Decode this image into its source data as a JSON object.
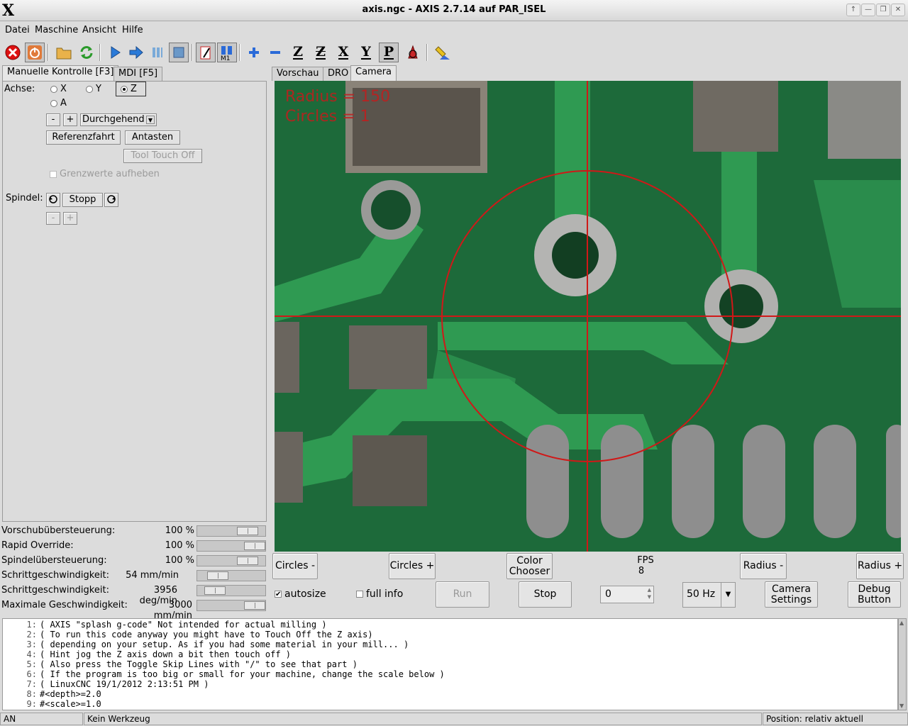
{
  "window": {
    "title": "axis.ngc - AXIS 2.7.14 auf  PAR_ISEL",
    "logo": "X"
  },
  "menu": [
    "Datei",
    "Maschine",
    "Ansicht",
    "Hilfe"
  ],
  "left_tabs": [
    "Manuelle Kontrolle [F3]",
    "MDI [F5]"
  ],
  "right_tabs": [
    "Vorschau",
    "DRO",
    "Camera"
  ],
  "manual": {
    "axis_label": "Achse:",
    "axes": [
      "X",
      "Y",
      "Z",
      "A"
    ],
    "selected_axis": "Z",
    "jog_minus": "-",
    "jog_plus": "+",
    "jog_mode": "Durchgehend",
    "home_button": "Referenzfahrt",
    "touch_button": "Antasten",
    "tool_touch_off": "Tool Touch Off",
    "override_limits": "Grenzwerte aufheben",
    "spindle_label": "Spindel:",
    "spindle_stop": "Stopp",
    "spindle_minus": "-",
    "spindle_plus": "+"
  },
  "sliders": [
    {
      "label": "Vorschubübersteuerung:",
      "value": "100 %",
      "fraction": 0.85
    },
    {
      "label": "Rapid Override:",
      "value": "100 %",
      "fraction": 0.9
    },
    {
      "label": "Spindelübersteuerung:",
      "value": "100 %",
      "fraction": 0.85
    },
    {
      "label": "Schrittgeschwindigkeit:",
      "value": "54 mm/min",
      "fraction": 0.15
    },
    {
      "label": "Schrittgeschwindigkeit:",
      "value": "3956 deg/min",
      "fraction": 0.12
    },
    {
      "label": "Maximale Geschwindigkeit:",
      "value": "3000 mm/min",
      "fraction": 0.9
    }
  ],
  "camera": {
    "overlay_radius": "Radius = 150",
    "overlay_circles": "Circles = 1",
    "circles_minus": "Circles -",
    "circles_plus": "Circles +",
    "color_chooser": "Color Chooser",
    "fps_label": "FPS",
    "fps_value": "8",
    "radius_minus": "Radius -",
    "radius_plus": "Radius +",
    "autosize": "autosize",
    "autosize_checked": true,
    "full_info": "full info",
    "full_info_checked": false,
    "run": "Run",
    "stop": "Stop",
    "spin_value": "0",
    "frequency": "50 Hz",
    "camera_settings": "Camera Settings",
    "debug_button": "Debug Button"
  },
  "gcode": [
    {
      "n": "1:",
      "text": "( AXIS \"splash g-code\" Not intended for actual milling )"
    },
    {
      "n": "2:",
      "text": "( To run this code anyway you might have to Touch Off the Z axis)"
    },
    {
      "n": "3:",
      "text": "( depending on your setup. As if you had some material in your mill... )"
    },
    {
      "n": "4:",
      "text": "( Hint jog the Z axis down a bit then touch off )"
    },
    {
      "n": "5:",
      "text": "( Also press the Toggle Skip Lines with \"/\" to see that part )"
    },
    {
      "n": "6:",
      "text": "( If the program is too big or small for your machine, change the scale below )"
    },
    {
      "n": "7:",
      "text": "( LinuxCNC 19/1/2012 2:13:51 PM )"
    },
    {
      "n": "8:",
      "text": "#<depth>=2.0"
    },
    {
      "n": "9:",
      "text": "#<scale>=1.0"
    }
  ],
  "status": {
    "state": "AN",
    "tool": "Kein Werkzeug",
    "position": "Position: relativ aktuell"
  }
}
